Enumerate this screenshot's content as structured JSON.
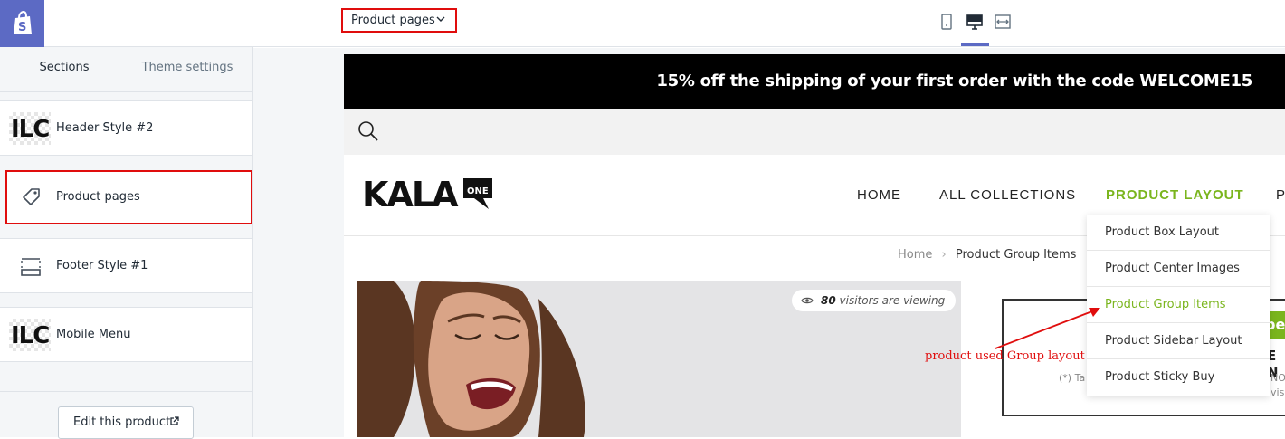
{
  "sidebar": {
    "tabs": [
      {
        "label": "Sections",
        "active": true
      },
      {
        "label": "Theme settings",
        "active": false
      }
    ],
    "sections": [
      {
        "label": "Header Style #2",
        "icon": "ilc-thumbnail"
      },
      {
        "label": "Product pages",
        "icon": "tag-icon",
        "highlighted": true
      },
      {
        "label": "Footer Style #1",
        "icon": "footer-layout-icon"
      },
      {
        "label": "Mobile Menu",
        "icon": "ilc-thumbnail"
      }
    ],
    "thumbnail_text": "ILC",
    "edit_button": "Edit this product"
  },
  "toolbar": {
    "page_select": "Product pages",
    "devices": [
      "mobile-icon",
      "desktop-icon",
      "full-width-icon"
    ],
    "active_device": "desktop"
  },
  "preview": {
    "announcement": "15% off the shipping of your first order with the code WELCOME15",
    "brand": "KALA",
    "brand_badge": "ONE",
    "nav": [
      "HOME",
      "ALL COLLECTIONS",
      "PRODUCT LAYOUT",
      "P"
    ],
    "breadcrumb": {
      "home": "Home",
      "current": "Product Group Items"
    },
    "viewers": {
      "count": "80",
      "text": "visitors are viewing"
    },
    "dropdown": [
      {
        "label": "Product Box Layout",
        "active": false
      },
      {
        "label": "Product Center Images",
        "active": false
      },
      {
        "label": "Product Group Items",
        "active": true
      },
      {
        "label": "Product Sidebar Layout",
        "active": false
      },
      {
        "label": "Product Sticky Buy",
        "active": false
      }
    ],
    "cart_fragments": {
      "green": "be",
      "bold": "E N",
      "small1": "(*) Ta",
      "small2": "NO",
      "small3": "vis"
    }
  },
  "annotation": {
    "text": "product used Group layout",
    "color": "#e00d0d"
  },
  "colors": {
    "accent": "#5c6ac4",
    "highlight": "#e00d0d",
    "nav_active": "#7ab51d"
  }
}
